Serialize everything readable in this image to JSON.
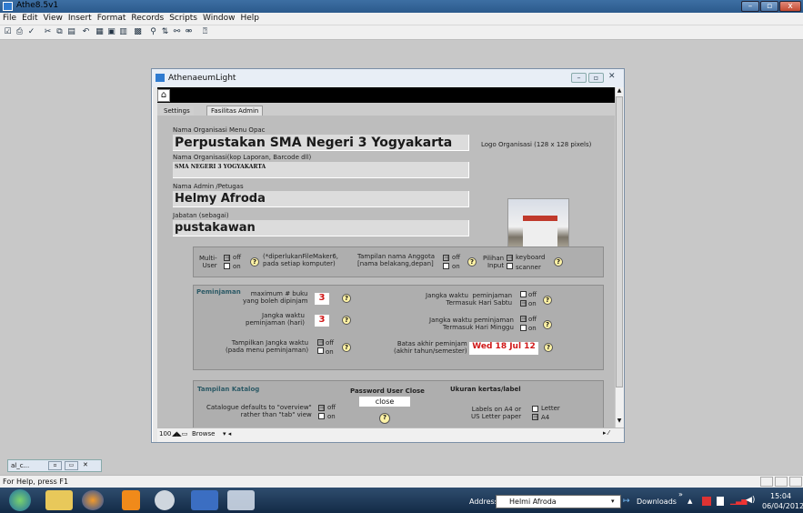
{
  "app": {
    "title": "Athe8.5v1"
  },
  "menu": [
    "File",
    "Edit",
    "View",
    "Insert",
    "Format",
    "Records",
    "Scripts",
    "Window",
    "Help"
  ],
  "inner_window": {
    "title": "AthenaeumLight"
  },
  "tabs": [
    "Settings",
    "Fasilitas Admin"
  ],
  "form": {
    "org_menu_label": "Nama Organisasi Menu Opac",
    "org_menu_value": "Perpustakan SMA Negeri 3 Yogyakarta",
    "org_kop_label": "Nama Organisasi(kop Laporan, Barcode dll)",
    "org_kop_value": "SMA NEGERI 3 YOGYAKARTA",
    "admin_label": "Nama Admin /Petugas",
    "admin_value": "Helmy Afroda",
    "jabatan_label": "Jabatan (sebagai)",
    "jabatan_value": "pustakawan",
    "logo_label": "Logo Organisasi (128 x 128 pixels)"
  },
  "panel1": {
    "multi_user_label": "Multi-\nUser",
    "off": "off",
    "on": "on",
    "multi_user_note": "(*diperlukanFileMaker6,\npada setiap komputer)",
    "tampilan_label": "Tampilan nama Anggota\n[nama belakang,depan]",
    "pilihan_label": "Pilihan\nInput",
    "keyboard": "keyboard",
    "scanner": "scanner"
  },
  "peminjaman": {
    "title": "Peminjaman",
    "max_buku_label": "maximum # buku\nyang boleh dipinjam",
    "max_buku_value": "3",
    "jangka_label": "Jangka waktu\npeminjaman (hari)",
    "jangka_value": "3",
    "tampilkan_label": "Tampilkan Jangka waktu\n(pada menu peminjaman)",
    "sabtu_label": "Jangka waktu  peminjaman\nTermasuk Hari Sabtu",
    "minggu_label": "Jangka waktu peminjaman\nTermasuk Hari Minggu",
    "batas_label": "Batas akhir peminjam\n(akhir tahun/semester)",
    "batas_value": "Wed 18 Jul 12"
  },
  "katalog": {
    "title": "Tampilan Katalog",
    "overview_label": "Catalogue defaults to \"overview\"\nrather than \"tab\" view",
    "password_title": "Password User Close",
    "password_value": "close",
    "ukuran_title": "Ukuran kertas/label",
    "labels_label": "Labels on A4 or\nUS Letter paper",
    "letter": "Letter",
    "a4": "A4"
  },
  "bottom_bar": {
    "zoom": "100",
    "mode": "Browse"
  },
  "minimized": {
    "label": "al_c..."
  },
  "status": {
    "text": "For Help, press F1"
  },
  "taskbar": {
    "address_label": "Address",
    "address_value": "Helmi Afroda",
    "downloads": "Downloads",
    "time": "15:04",
    "date": "06/04/2012"
  }
}
